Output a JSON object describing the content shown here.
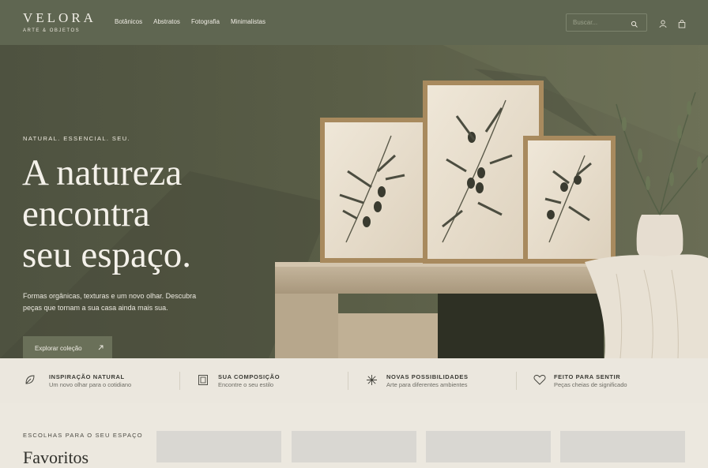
{
  "brand": {
    "name": "VELORA",
    "tagline": "ARTE & OBJETOS"
  },
  "nav": [
    "Botânicos",
    "Abstratos",
    "Fotografia",
    "Minimalistas"
  ],
  "search": {
    "placeholder": "Buscar..."
  },
  "header_icons": [
    "search-icon",
    "user-icon",
    "bag-icon"
  ],
  "hero": {
    "eyebrow": "NATURAL. ESSENCIAL. SEU.",
    "headline": [
      "A natureza",
      "encontra",
      "seu espaço."
    ],
    "lead": "Formas orgânicas, texturas e um novo olhar. Descubra peças que tornam a sua casa ainda mais sua.",
    "cta": "Explorar coleção",
    "cta_icon": "arrow-up-right-icon"
  },
  "features": [
    {
      "icon": "leaf-icon",
      "title": "INSPIRAÇÃO NATURAL",
      "subtitle": "Um novo olhar para o cotidiano"
    },
    {
      "icon": "frame-icon",
      "title": "SUA COMPOSIÇÃO",
      "subtitle": "Encontre o seu estilo"
    },
    {
      "icon": "sparkle-icon",
      "title": "NOVAS POSSIBILIDADES",
      "subtitle": "Arte para diferentes ambientes"
    },
    {
      "icon": "heart-icon",
      "title": "FEITO PARA SENTIR",
      "subtitle": "Peças cheias de significado"
    }
  ],
  "collection": {
    "label": "ESCOLHAS PARA O SEU ESPAÇO",
    "heading": "Favoritos"
  },
  "colors": {
    "header": "#5f6651",
    "accent": "#6a7059",
    "background": "#ece8df"
  }
}
